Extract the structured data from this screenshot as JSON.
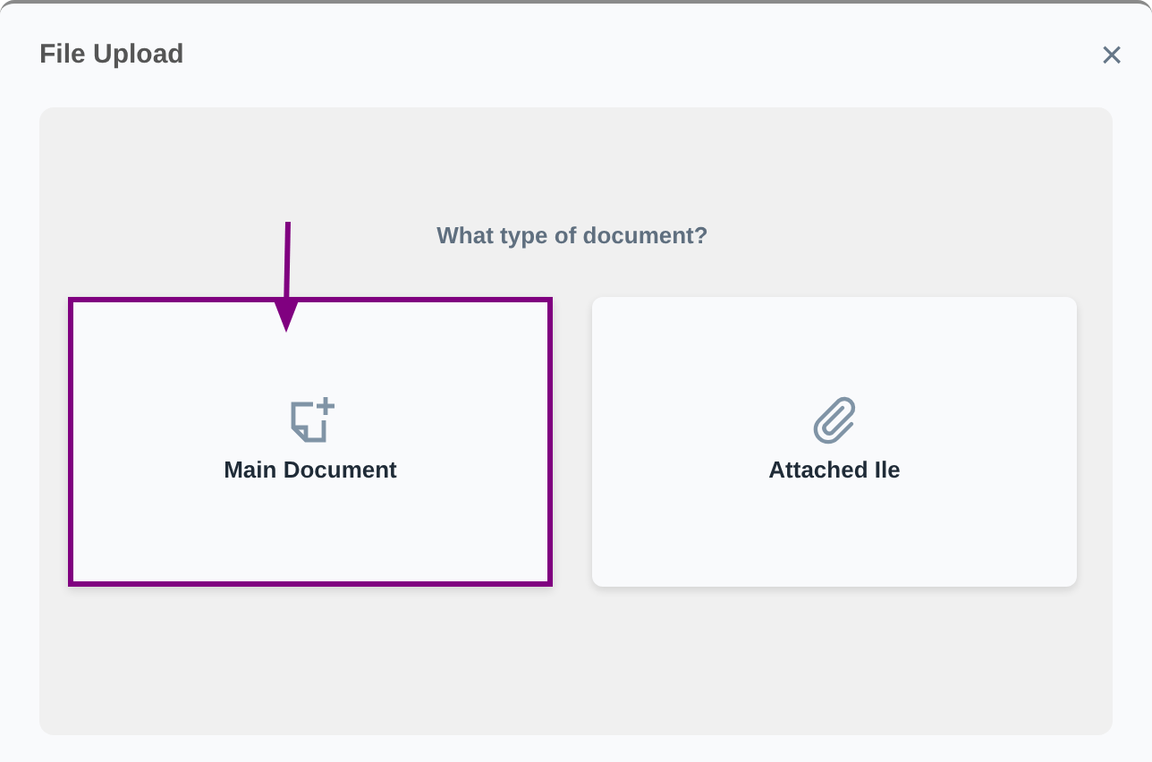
{
  "dialog": {
    "title": "File Upload",
    "close": "×"
  },
  "question": "What type of document?",
  "options": [
    {
      "kind": "document",
      "label": "Main Document",
      "highlighted": true
    },
    {
      "kind": "attachment",
      "label": "Attached Ile",
      "highlighted": false
    }
  ]
}
